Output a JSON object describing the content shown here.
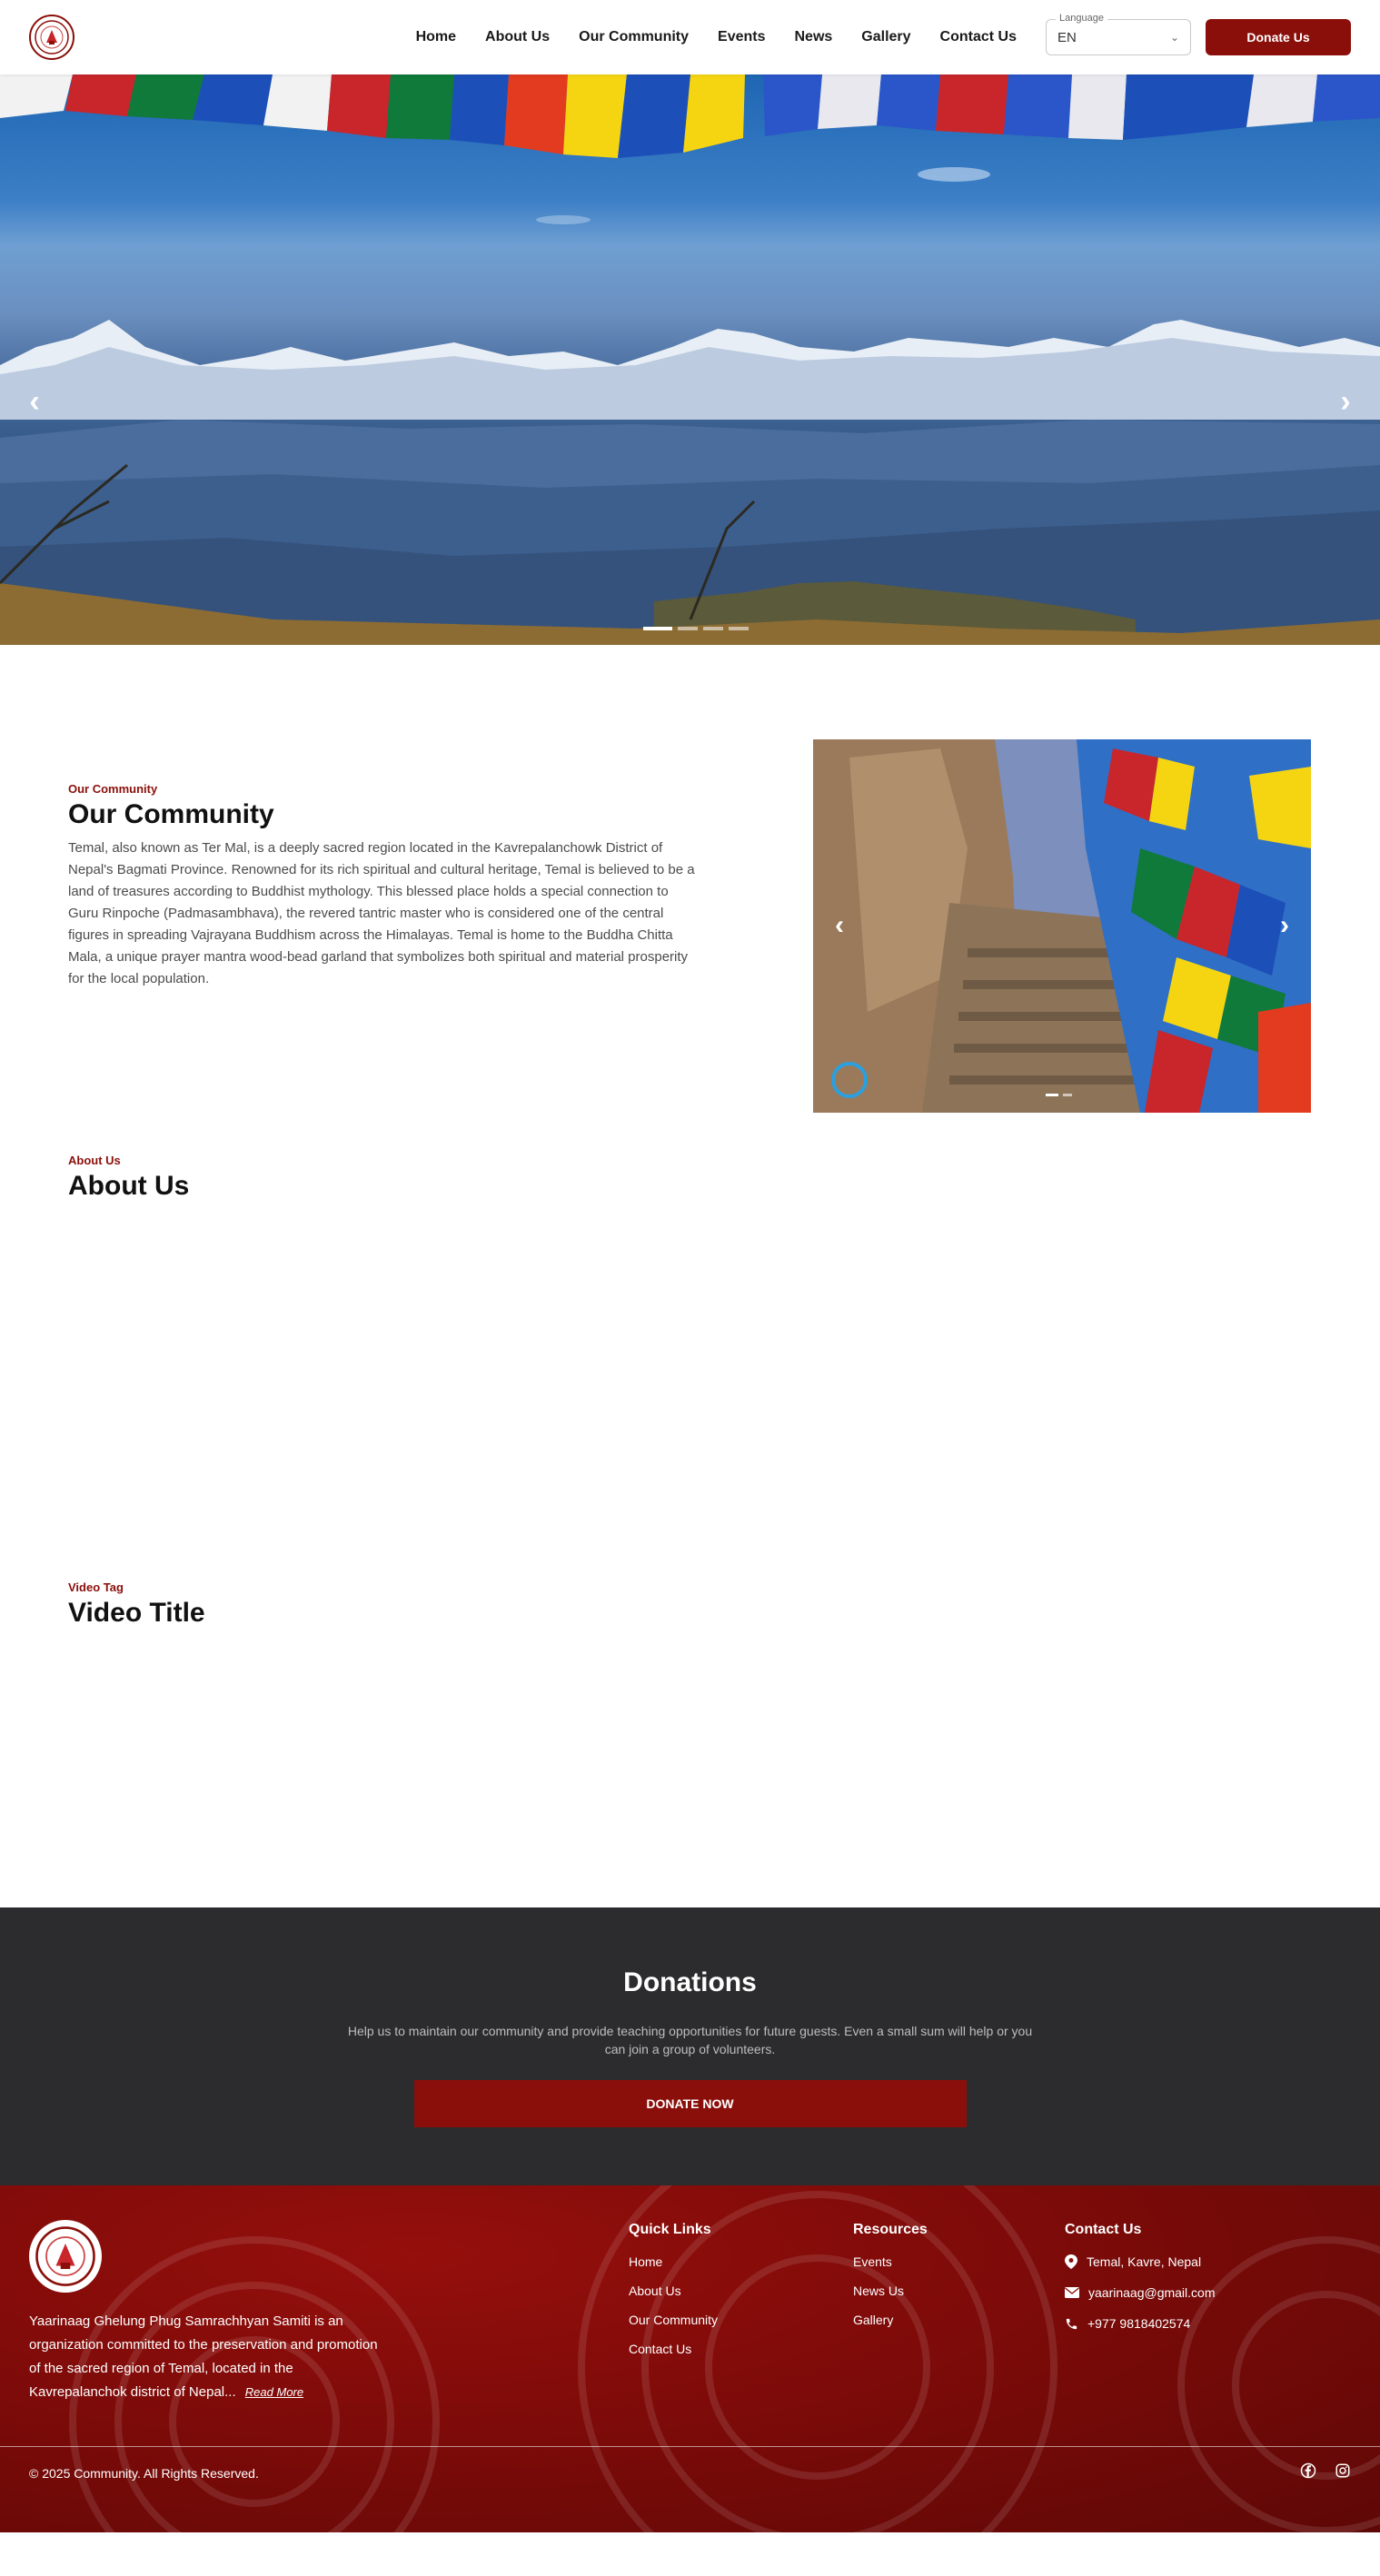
{
  "header": {
    "nav": [
      "Home",
      "About Us",
      "Our Community",
      "Events",
      "News",
      "Gallery",
      "Contact Us"
    ],
    "language_label": "Language",
    "language_value": "EN",
    "donate_label": "Donate Us"
  },
  "hero": {
    "slides": 4,
    "active_slide": 1
  },
  "community": {
    "tag": "Our Community",
    "title": "Our Community",
    "body": "Temal, also known as Ter Mal, is a deeply sacred region located in the Kavrepalanchowk District of Nepal's Bagmati Province. Renowned for its rich spiritual and cultural heritage, Temal is believed to be a land of treasures according to Buddhist mythology. This blessed place holds a special connection to Guru Rinpoche (Padmasambhava), the revered tantric master who is considered one of the central figures in spreading Vajrayana Buddhism across the Himalayas. Temal is home to the Buddha Chitta Mala, a unique prayer mantra wood-bead garland that symbolizes both spiritual and material prosperity for the local population."
  },
  "about": {
    "tag": "About Us",
    "title": "About Us"
  },
  "video": {
    "tag": "Video Tag",
    "title": "Video Title"
  },
  "donations": {
    "title": "Donations",
    "text": "Help us to maintain our community and provide teaching opportunities for future guests. Even a small sum will help or you can join a group of volunteers.",
    "button": "DONATE NOW"
  },
  "footer": {
    "about": "Yaarinaag Ghelung Phug Samrachhyan Samiti is an organization committed to the preservation and promotion of the sacred region of Temal, located in the Kavrepalanchok district of Nepal...",
    "read_more": "Read More",
    "quick_links_title": "Quick Links",
    "quick_links": [
      "Home",
      "About Us",
      "Our Community",
      "Contact Us"
    ],
    "resources_title": "Resources",
    "resources": [
      "Events",
      "News Us",
      "Gallery"
    ],
    "contact_title": "Contact Us",
    "contact": {
      "address": "Temal, Kavre, Nepal",
      "email": "yaarinaag@gmail.com",
      "phone": "+977 9818402574"
    },
    "copyright": "© 2025 Community. All Rights Reserved."
  },
  "colors": {
    "brand": "#8a0f0a",
    "dark_band": "#2c2c2e"
  }
}
